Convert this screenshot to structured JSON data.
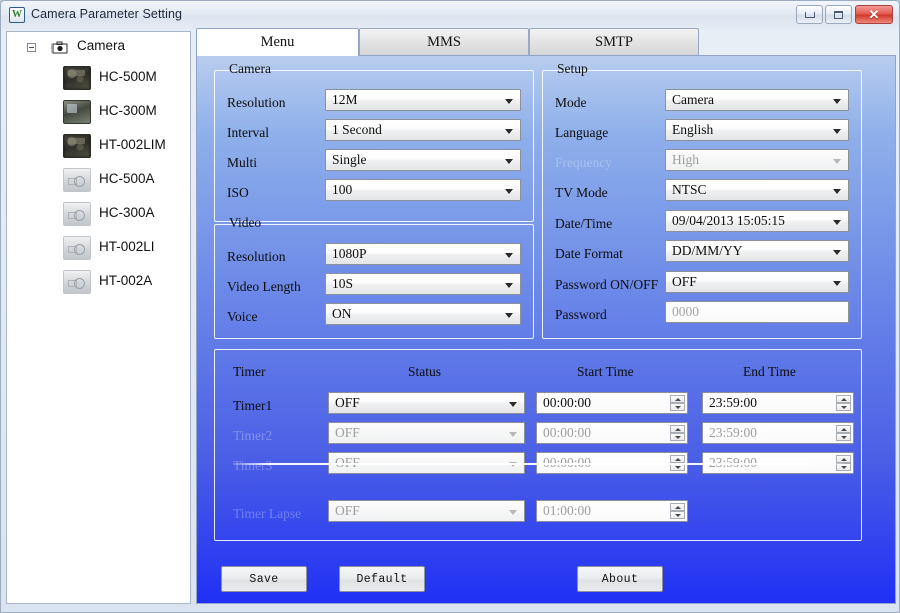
{
  "window": {
    "title": "Camera Parameter Setting",
    "icon": "app-w-icon",
    "controls": {
      "minimize": "minimize",
      "maximize": "maximize",
      "close": "✕"
    }
  },
  "sidebar": {
    "root": {
      "label": "Camera",
      "icon": "camera-root-icon",
      "expander": "collapse-toggle"
    },
    "items": [
      {
        "label": "HC-500M",
        "icon": "camera-thumb-dark"
      },
      {
        "label": "HC-300M",
        "icon": "camera-thumb-mid"
      },
      {
        "label": "HT-002LIM",
        "icon": "camera-thumb-dark"
      },
      {
        "label": "HC-500A",
        "icon": "camera-thumb-grey"
      },
      {
        "label": "HC-300A",
        "icon": "camera-thumb-grey"
      },
      {
        "label": "HT-002LI",
        "icon": "camera-thumb-grey"
      },
      {
        "label": "HT-002A",
        "icon": "camera-thumb-grey"
      }
    ]
  },
  "tabs": [
    {
      "label": "Menu",
      "active": true
    },
    {
      "label": "MMS",
      "active": false
    },
    {
      "label": "SMTP",
      "active": false
    }
  ],
  "groups": {
    "camera": {
      "legend": "Camera",
      "rows": [
        {
          "label": "Resolution",
          "value": "12M",
          "control": "dropdown"
        },
        {
          "label": "Interval",
          "value": "1  Second",
          "control": "dropdown"
        },
        {
          "label": "Multi",
          "value": "Single",
          "control": "dropdown"
        },
        {
          "label": "ISO",
          "value": "100",
          "control": "dropdown"
        }
      ]
    },
    "video": {
      "legend": "Video",
      "rows": [
        {
          "label": "Resolution",
          "value": "1080P",
          "control": "dropdown"
        },
        {
          "label": "Video Length",
          "value": "10S",
          "control": "dropdown"
        },
        {
          "label": "Voice",
          "value": "ON",
          "control": "dropdown"
        }
      ]
    },
    "setup": {
      "legend": "Setup",
      "rows": [
        {
          "label": "Mode",
          "value": "Camera",
          "control": "dropdown",
          "disabled": false
        },
        {
          "label": "Language",
          "value": "English",
          "control": "dropdown",
          "disabled": false
        },
        {
          "label": "Frequency",
          "value": "High",
          "control": "dropdown",
          "disabled": true
        },
        {
          "label": "TV Mode",
          "value": "NTSC",
          "control": "dropdown",
          "disabled": false
        },
        {
          "label": "Date/Time",
          "value": "09/04/2013 15:05:15",
          "control": "dropdown",
          "disabled": false
        },
        {
          "label": "Date Format",
          "value": "DD/MM/YY",
          "control": "dropdown",
          "disabled": false
        },
        {
          "label": "Password ON/OFF",
          "value": "OFF",
          "control": "dropdown",
          "disabled": false
        },
        {
          "label": "Password",
          "value": "0000",
          "control": "textbox",
          "disabled": false,
          "placeholder": true
        }
      ]
    },
    "timer": {
      "headers": [
        "Timer",
        "Status",
        "Start Time",
        "End Time"
      ],
      "rows": [
        {
          "label": "Timer1",
          "status": "OFF",
          "start": "00:00:00",
          "end": "23:59:00",
          "disabled": false
        },
        {
          "label": "Timer2",
          "status": "OFF",
          "start": "00:00:00",
          "end": "23:59:00",
          "disabled": true
        },
        {
          "label": "Timer3",
          "status": "OFF",
          "start": "00:00:00",
          "end": "23:59:00",
          "disabled": true
        }
      ],
      "lapse": {
        "label": "Timer Lapse",
        "status": "OFF",
        "start": "01:00:00",
        "disabled": true
      }
    }
  },
  "buttons": {
    "save": "Save",
    "default": "Default",
    "about": "About"
  },
  "colors": {
    "panel_top": "#b8cdef",
    "panel_bottom": "#2030f5",
    "accent": "#2030f5",
    "close_button": "#cf3a2d",
    "field_bg": "#ffffff"
  }
}
